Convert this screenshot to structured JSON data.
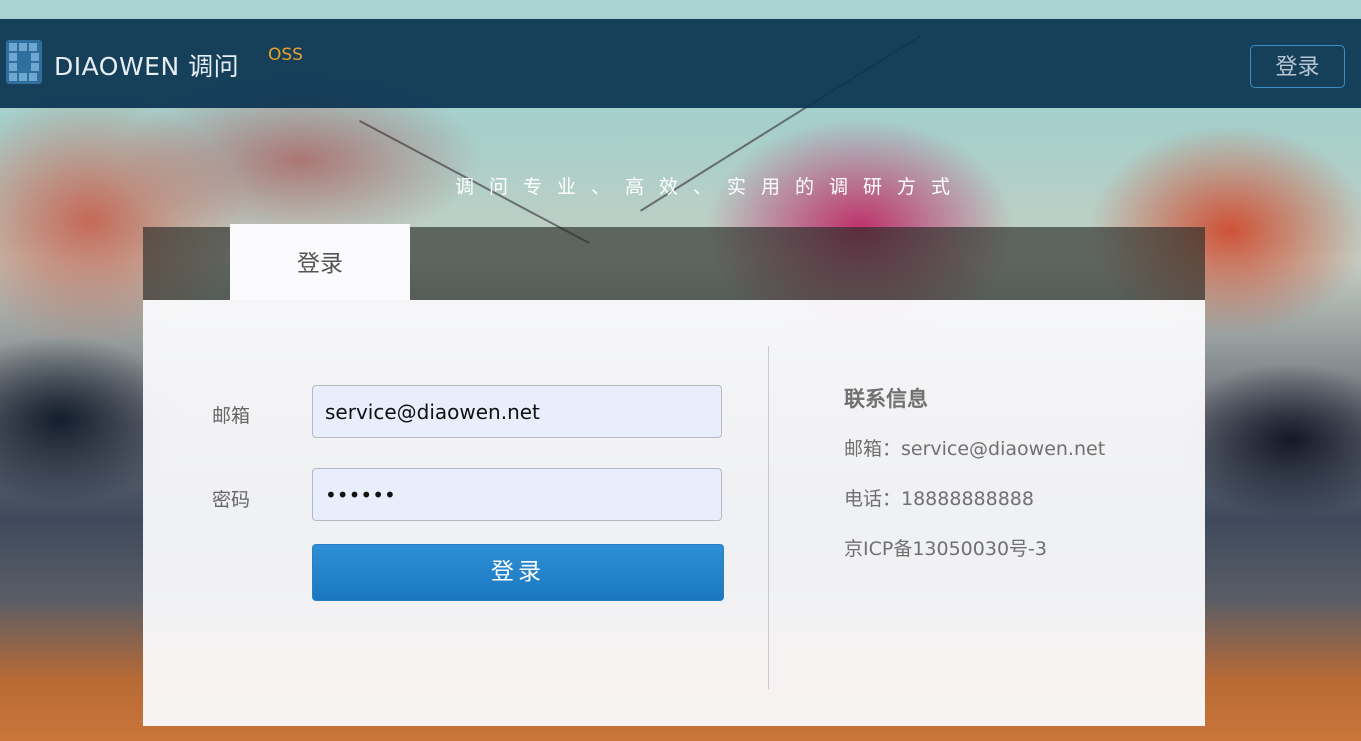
{
  "header": {
    "logo_text": "DIAOWEN 调问",
    "logo_suffix": "OSS",
    "login_button": "登录"
  },
  "slogan": "调问专业、高效、实用的调研方式",
  "tabs": [
    {
      "label": "登录",
      "active": true
    }
  ],
  "form": {
    "email_label": "邮箱",
    "email_value": "service@diaowen.net",
    "password_label": "密码",
    "password_value": "••••••",
    "submit_label": "登录"
  },
  "contact": {
    "title": "联系信息",
    "email": "邮箱：service@diaowen.net",
    "phone": "电话：18888888888",
    "icp": "京ICP备13050030号-3"
  },
  "colors": {
    "header_bg": "#0a3250",
    "accent_orange": "#e8a22a",
    "button_blue": "#1b78c0",
    "border_blue": "#3a8fc7"
  }
}
